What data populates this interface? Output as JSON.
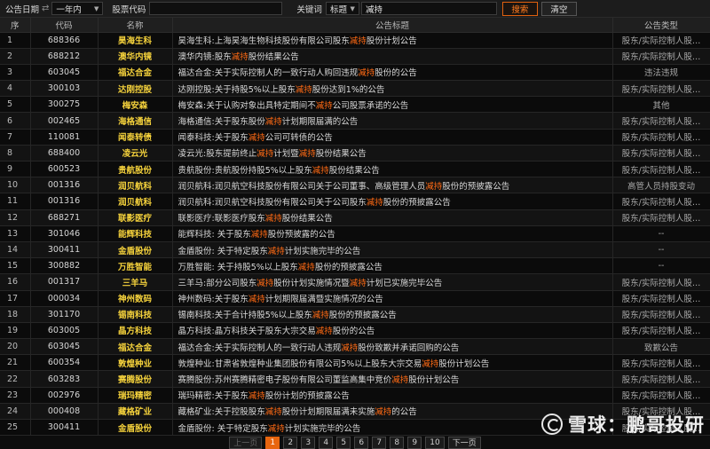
{
  "filter": {
    "date_label": "公告日期",
    "date_value": "一年内",
    "stock_label": "股票代码",
    "stock_value": "",
    "keyword_label": "关键词",
    "scope_value": "标题",
    "keyword_value": "减持",
    "search_label": "搜索",
    "clear_label": "清空"
  },
  "headers": [
    "序",
    "代码",
    "名称",
    "公告标题",
    "公告类型"
  ],
  "highlight_word": "减持",
  "rows": [
    {
      "seq": "1",
      "code": "688366",
      "name": "昊海生科",
      "pre": "昊海生科:上海昊海生物科技股份有限公司股东",
      "post": "股份计划公告",
      "type": "股东/实际控制人股…"
    },
    {
      "seq": "2",
      "code": "688212",
      "name": "澳华内镜",
      "pre": "澳华内镜:股东",
      "post": "股份结果公告",
      "type": "股东/实际控制人股…"
    },
    {
      "seq": "3",
      "code": "603045",
      "name": "福达合金",
      "pre": "福达合金:关于实际控制人的一致行动人购回违规",
      "post": "股份的公告",
      "type": "违法违规"
    },
    {
      "seq": "4",
      "code": "300103",
      "name": "达刚控股",
      "pre": "达刚控股:关于持股5%以上股东",
      "post": "股份达到1%的公告",
      "type": "股东/实际控制人股…"
    },
    {
      "seq": "5",
      "code": "300275",
      "name": "梅安森",
      "pre": "梅安森:关于认购对象出具特定期间不",
      "post": "公司股票承诺的公告",
      "type": "其他"
    },
    {
      "seq": "6",
      "code": "002465",
      "name": "海格通信",
      "pre": "海格通信:关于股东股份",
      "post": "计划期限届满的公告",
      "type": "股东/实际控制人股…"
    },
    {
      "seq": "7",
      "code": "110081",
      "name": "闻泰转债",
      "pre": "闻泰科技:关于股东",
      "post": "公司可转债的公告",
      "type": "股东/实际控制人股…"
    },
    {
      "seq": "8",
      "code": "688400",
      "name": "凌云光",
      "pre": "凌云光:股东提前终止",
      "post": "计划暨",
      "post2": "股份结果公告",
      "type": "股东/实际控制人股…"
    },
    {
      "seq": "9",
      "code": "600523",
      "name": "贵航股份",
      "pre": "贵航股份:贵航股份持股5%以上股东",
      "post": "股份结果公告",
      "type": "股东/实际控制人股…"
    },
    {
      "seq": "10",
      "code": "001316",
      "name": "润贝航科",
      "pre": "润贝航科:润贝航空科技股份有限公司关于公司董事、高级管理人员",
      "post": "股份的预披露公告",
      "type": "高管人员持股变动"
    },
    {
      "seq": "11",
      "code": "001316",
      "name": "润贝航科",
      "pre": "润贝航科:润贝航空科技股份有限公司关于公司股东",
      "post": "股份的预披露公告",
      "type": "股东/实际控制人股…"
    },
    {
      "seq": "12",
      "code": "688271",
      "name": "联影医疗",
      "pre": "联影医疗:联影医疗股东",
      "post": "股份结果公告",
      "type": "股东/实际控制人股…"
    },
    {
      "seq": "13",
      "code": "301046",
      "name": "能辉科技",
      "pre": "能辉科技: 关于股东",
      "post": "股份预披露的公告",
      "type": "--"
    },
    {
      "seq": "14",
      "code": "300411",
      "name": "金盾股份",
      "pre": "金盾股份: 关于特定股东",
      "post": "计划实施完毕的公告",
      "type": "--"
    },
    {
      "seq": "15",
      "code": "300882",
      "name": "万胜智能",
      "pre": "万胜智能: 关于持股5%以上股东",
      "post": "股份的预披露公告",
      "type": "--"
    },
    {
      "seq": "16",
      "code": "001317",
      "name": "三羊马",
      "pre": "三羊马:部分公司股东",
      "post": "股份计划实施情况暨",
      "post2": "计划已实施完毕公告",
      "type": "股东/实际控制人股…"
    },
    {
      "seq": "17",
      "code": "000034",
      "name": "神州数码",
      "pre": "神州数码:关于股东",
      "post": "计划期限届满暨实施情况的公告",
      "type": "股东/实际控制人股…"
    },
    {
      "seq": "18",
      "code": "301170",
      "name": "锡南科技",
      "pre": "锡南科技:关于合计持股5%以上股东",
      "post": "股份的预披露公告",
      "type": "股东/实际控制人股…"
    },
    {
      "seq": "19",
      "code": "603005",
      "name": "晶方科技",
      "pre": "晶方科技:晶方科技关于股东大宗交易",
      "post": "股份的公告",
      "type": "股东/实际控制人股…"
    },
    {
      "seq": "20",
      "code": "603045",
      "name": "福达合金",
      "pre": "福达合金:关于实际控制人的一致行动人违规",
      "post": "股份致歉并承诺回购的公告",
      "type": "致歉公告"
    },
    {
      "seq": "21",
      "code": "600354",
      "name": "敦煌种业",
      "pre": "敦煌种业:甘肃省敦煌种业集团股份有限公司5%以上股东大宗交易",
      "post": "股份计划公告",
      "type": "股东/实际控制人股…"
    },
    {
      "seq": "22",
      "code": "603283",
      "name": "赛腾股份",
      "pre": "赛腾股份:苏州赛腾精密电子股份有限公司董监高集中竞价",
      "post": "股份计划公告",
      "type": "股东/实际控制人股…"
    },
    {
      "seq": "23",
      "code": "002976",
      "name": "瑞玛精密",
      "pre": "瑞玛精密:关于股东",
      "post": "股份计划的预披露公告",
      "type": "股东/实际控制人股…"
    },
    {
      "seq": "24",
      "code": "000408",
      "name": "藏格矿业",
      "pre": "藏格矿业:关于控股股东",
      "post": "股份计划期限届满未实施",
      "post2": "的公告",
      "type": "股东/实际控制人股…"
    },
    {
      "seq": "25",
      "code": "300411",
      "name": "金盾股份",
      "pre": "金盾股份: 关于特定股东",
      "post": "计划实施完毕的公告",
      "type": "股东/实际控制人股…"
    }
  ],
  "pager": {
    "prev": "上一页",
    "pages": [
      "1",
      "2",
      "3",
      "4",
      "5",
      "6",
      "7",
      "8",
      "9",
      "10"
    ],
    "active": "1",
    "next": "下一页"
  },
  "watermark": "雪球：鹏哥投研",
  "colors": {
    "accent": "#ff6a14",
    "name": "#f5d23c",
    "background": "#0d0d0d"
  }
}
